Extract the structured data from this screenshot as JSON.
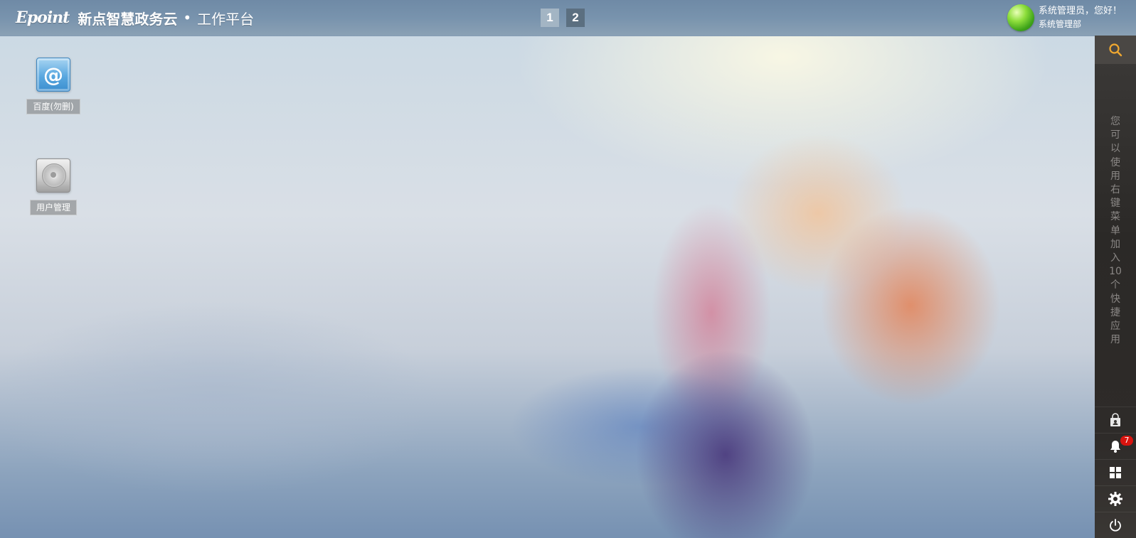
{
  "header": {
    "logo_text": "Epoint",
    "title": "新点智慧政务云",
    "separator": "•",
    "subtitle": "工作平台"
  },
  "pager": {
    "pages": [
      "1",
      "2"
    ],
    "active_page": "1"
  },
  "user": {
    "greeting": "系统管理员，您好！",
    "department": "系统管理部"
  },
  "desktop": {
    "apps": [
      {
        "label": "百度(勿删)",
        "icon": "mail-at-icon"
      },
      {
        "label": "用户管理",
        "icon": "hard-disk-icon"
      }
    ]
  },
  "sidebar": {
    "search_icon": "search-icon",
    "hint": "您可以使用右键菜单加入10个快捷应用",
    "tools": [
      {
        "name": "app-store",
        "icon": "shopping-bag-icon"
      },
      {
        "name": "notifications",
        "icon": "bell-icon",
        "badge": "7"
      },
      {
        "name": "apps-grid",
        "icon": "grid-icon"
      },
      {
        "name": "settings",
        "icon": "gear-icon"
      },
      {
        "name": "power",
        "icon": "power-icon"
      }
    ]
  },
  "colors": {
    "topbar": "#7893ad",
    "sidebar": "#2b2927",
    "search_accent": "#f0a830",
    "badge": "#d9140f"
  }
}
